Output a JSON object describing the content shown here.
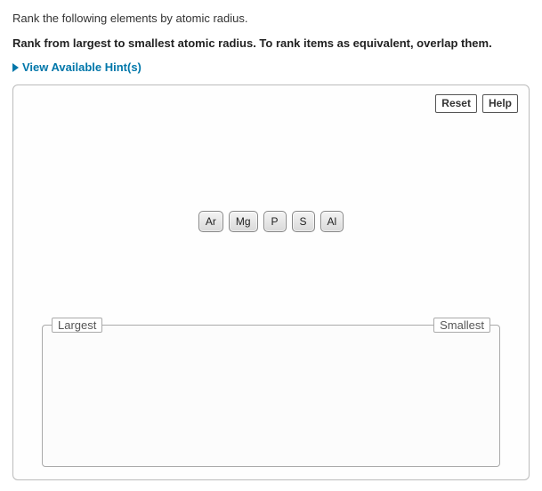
{
  "prompt": "Rank the following elements by atomic radius.",
  "instruction": "Rank from largest to smallest atomic radius. To rank items as equivalent, overlap them.",
  "hints": {
    "label": "View Available Hint(s)"
  },
  "toolbar": {
    "reset_label": "Reset",
    "help_label": "Help"
  },
  "tiles": [
    {
      "label": "Ar"
    },
    {
      "label": "Mg"
    },
    {
      "label": "P"
    },
    {
      "label": "S"
    },
    {
      "label": "Al"
    }
  ],
  "drop": {
    "left_label": "Largest",
    "right_label": "Smallest"
  }
}
